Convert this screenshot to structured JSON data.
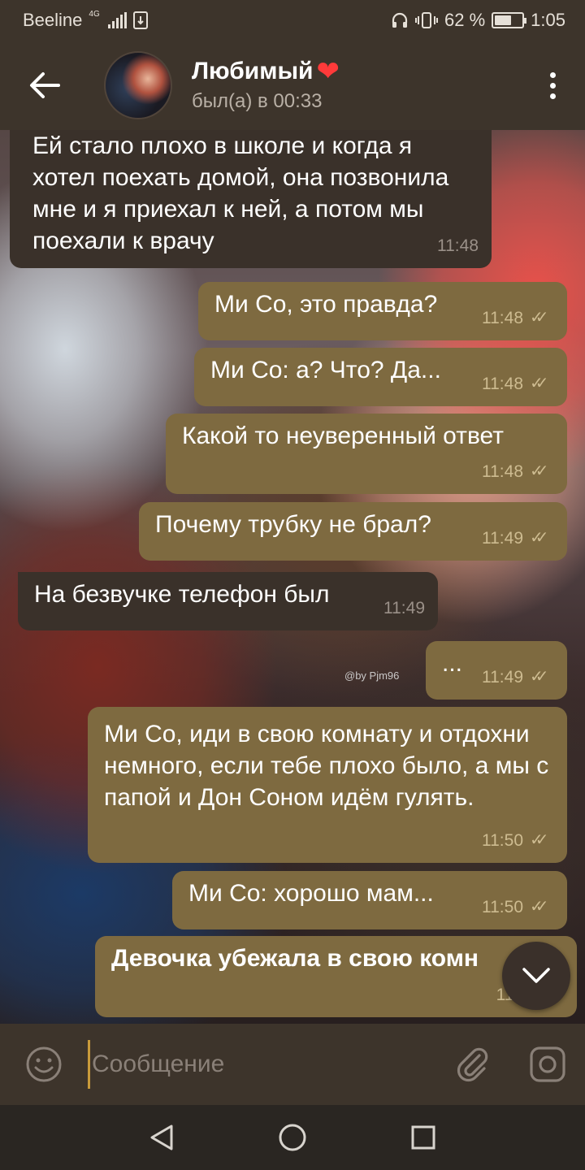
{
  "status_bar": {
    "carrier": "Beeline",
    "network": "4G",
    "battery_percent": "62 %",
    "battery_level": 0.62,
    "time": "1:05"
  },
  "header": {
    "title": "Любимый",
    "status": "был(а) в 00:33"
  },
  "wallpaper": {
    "watermark": "@by Pjm96"
  },
  "messages": [
    {
      "direction": "in",
      "text": "Ей стало плохо в школе и когда я хотел поехать домой, она позвонила мне и я приехал к ней, а потом мы поехали к врачу",
      "time": "11:48"
    },
    {
      "direction": "out",
      "text": "Ми Со, это правда?",
      "time": "11:48",
      "read": true
    },
    {
      "direction": "out",
      "text": "Ми Со: а? Что? Да...",
      "time": "11:48",
      "read": true
    },
    {
      "direction": "out",
      "text": "Какой то неуверенный ответ",
      "time": "11:48",
      "read": true
    },
    {
      "direction": "out",
      "text": "Почему трубку не брал?",
      "time": "11:49",
      "read": true
    },
    {
      "direction": "in",
      "text": "На безвучке телефон был",
      "time": "11:49"
    },
    {
      "direction": "out",
      "text": "...",
      "time": "11:49",
      "read": true
    },
    {
      "direction": "out",
      "text": "Ми Со, иди в свою комнату и отдохни немного, если тебе плохо было, а мы с папой и Дон Соном идём гулять.",
      "time": "11:50",
      "read": true
    },
    {
      "direction": "out",
      "text": "Ми Со: хорошо мам...",
      "time": "11:50",
      "read": true
    },
    {
      "direction": "out",
      "text": "Девочка убежала в свою комн",
      "time": "11:5",
      "bold": true
    }
  ],
  "input": {
    "placeholder": "Сообщение"
  },
  "colors": {
    "bar": "#3d342b",
    "incoming_bubble": "#3a312a",
    "outgoing_bubble": "#7e6a40",
    "read_ticks": "#cdbb90",
    "cursor": "#c99a3a",
    "heart": "#ff3a3a"
  },
  "icons": {
    "back": "arrow-left-icon",
    "menu": "more-vertical-icon",
    "emoji": "smile-icon",
    "attach": "paperclip-icon",
    "camera": "instagram-camera-icon",
    "scroll": "chevron-down-icon",
    "nav_back": "triangle-back-icon",
    "nav_home": "circle-home-icon",
    "nav_recent": "square-recent-icon"
  }
}
